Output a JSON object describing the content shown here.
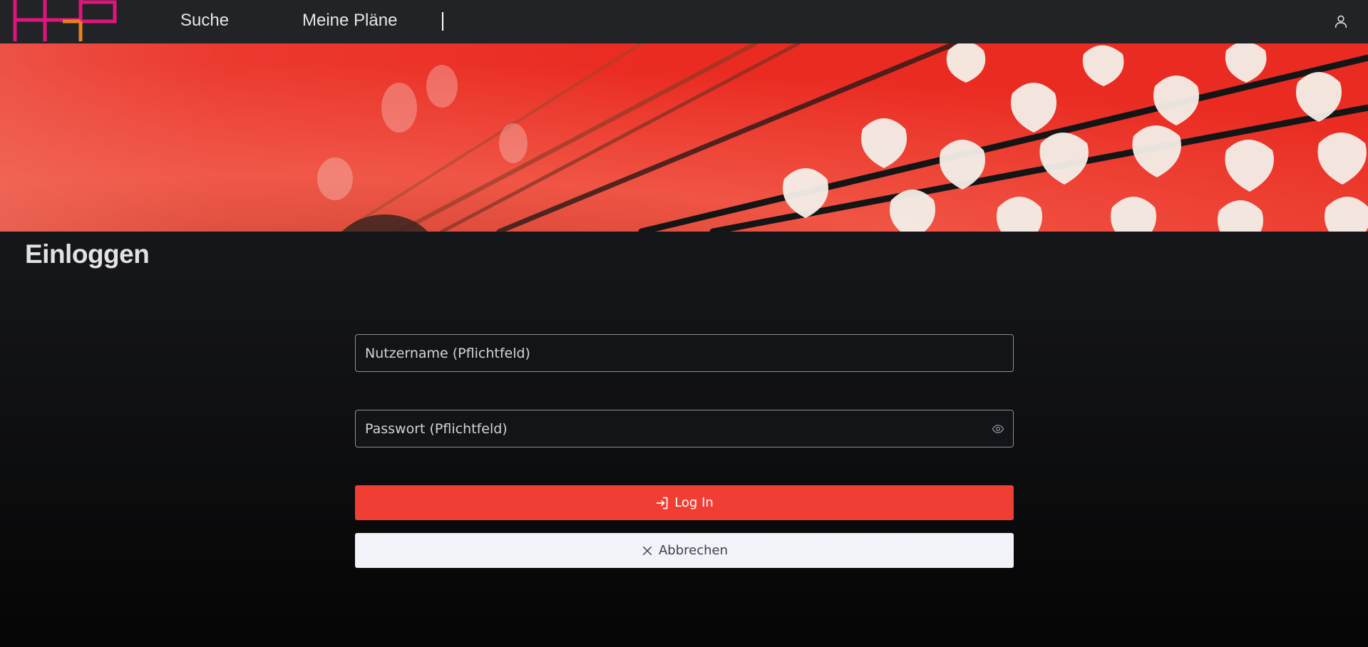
{
  "nav": {
    "links": [
      {
        "label": "Suche"
      },
      {
        "label": "Meine Pläne"
      }
    ],
    "user_icon": "user-icon"
  },
  "page": {
    "title": "Einloggen"
  },
  "form": {
    "username": {
      "placeholder": "Nutzername (Pflichtfeld)",
      "value": ""
    },
    "password": {
      "placeholder": "Passwort (Pflichtfeld)",
      "value": "",
      "toggle_icon": "eye-icon"
    },
    "login_label": "Log In",
    "login_icon": "sign-in-icon",
    "cancel_label": "Abbrechen",
    "cancel_icon": "close-icon"
  },
  "colors": {
    "topbar": "#222327",
    "primary": "#f03e35",
    "logo_magenta": "#e0157c",
    "logo_orange": "#e8821e",
    "cancel_bg": "#f1f3f8"
  }
}
